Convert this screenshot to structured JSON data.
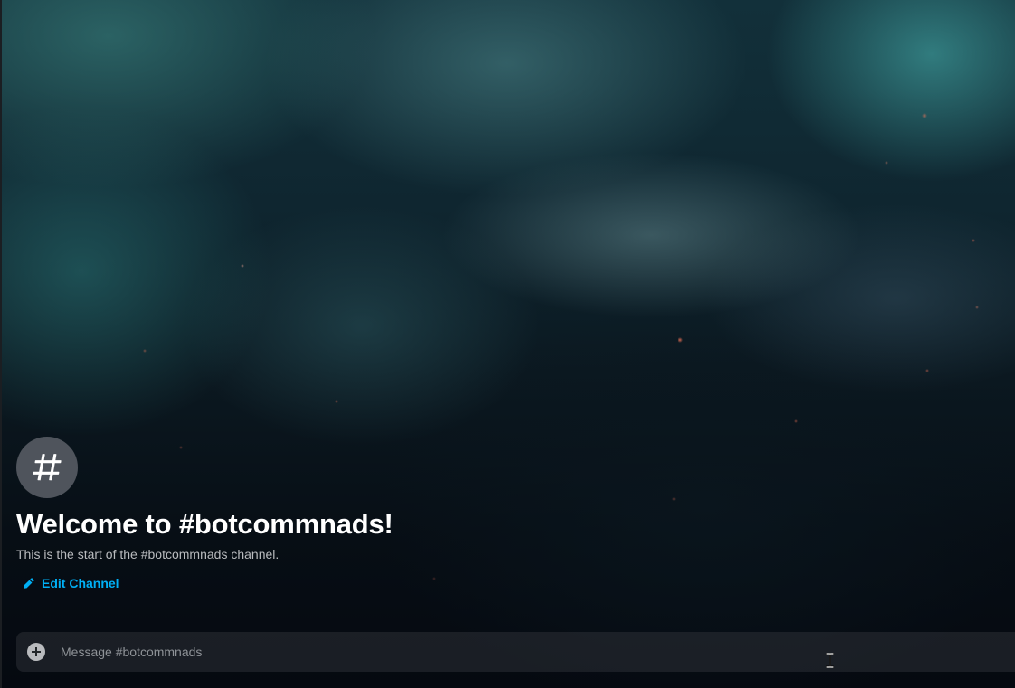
{
  "welcome": {
    "channel_icon": "hashtag-icon",
    "title": "Welcome to #botcommnads!",
    "subtitle": "This is the start of the #botcommnads channel.",
    "edit_label": "Edit Channel",
    "edit_icon": "pencil-icon"
  },
  "composer": {
    "attach_icon": "plus-circle-icon",
    "placeholder": "Message #botcommnads",
    "value": ""
  },
  "colors": {
    "accent_link": "#00aff4",
    "icon_circle": "#4f545c",
    "title_text": "#ffffff",
    "subtitle_text": "#b9bbbe"
  }
}
